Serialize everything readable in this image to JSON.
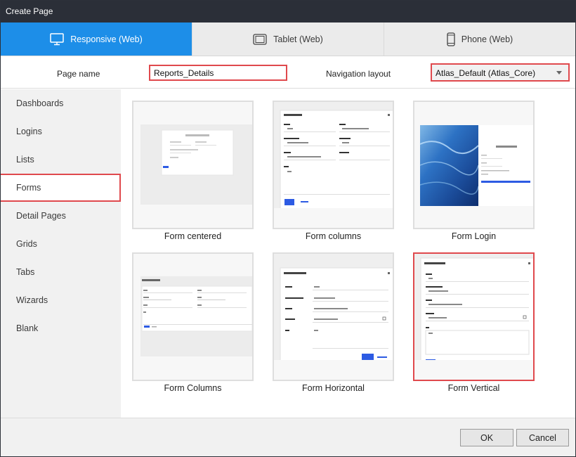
{
  "window": {
    "title": "Create Page"
  },
  "tabs": [
    {
      "label": "Responsive (Web)",
      "icon": "monitor-icon",
      "active": true
    },
    {
      "label": "Tablet (Web)",
      "icon": "tablet-icon",
      "active": false
    },
    {
      "label": "Phone (Web)",
      "icon": "phone-icon",
      "active": false
    }
  ],
  "form": {
    "page_name_label": "Page name",
    "page_name_value": "Reports_Details",
    "nav_layout_label": "Navigation layout",
    "nav_layout_value": "Atlas_Default (Atlas_Core)"
  },
  "sidebar": {
    "items": [
      "Dashboards",
      "Logins",
      "Lists",
      "Forms",
      "Detail Pages",
      "Grids",
      "Tabs",
      "Wizards",
      "Blank"
    ],
    "selected": "Forms"
  },
  "templates": [
    {
      "label": "Form centered",
      "selected": false
    },
    {
      "label": "Form columns",
      "selected": false
    },
    {
      "label": "Form Login",
      "selected": false
    },
    {
      "label": "Form Columns",
      "selected": false
    },
    {
      "label": "Form Horizontal",
      "selected": false
    },
    {
      "label": "Form Vertical",
      "selected": true
    }
  ],
  "footer": {
    "ok_label": "OK",
    "cancel_label": "Cancel"
  },
  "colors": {
    "accent": "#1d8ee8",
    "highlight": "#e0494d",
    "titlebar": "#2b2f38",
    "button_blue": "#2d5be3"
  }
}
